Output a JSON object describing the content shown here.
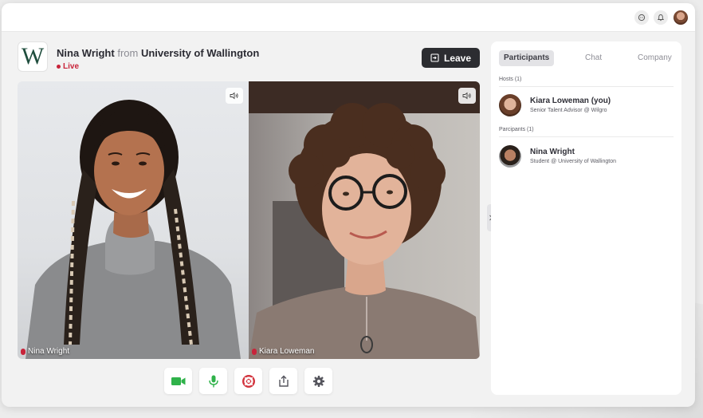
{
  "header": {
    "message_icon": "chat-bubble-icon",
    "notification_icon": "bell-icon",
    "user_avatar": "avatar"
  },
  "session": {
    "logo_letter": "W",
    "student_name": "Nina Wright",
    "from_text": "from",
    "university": "University of Wallington",
    "live_label": "Live",
    "leave_label": "Leave"
  },
  "videos": [
    {
      "name": "Nina Wright"
    },
    {
      "name": "Kiara Loweman"
    }
  ],
  "controls": [
    {
      "icon": "camera-icon",
      "color": "#2fb24a"
    },
    {
      "icon": "microphone-icon",
      "color": "#2fb24a"
    },
    {
      "icon": "lifebuoy-icon",
      "color": "#d2323c"
    },
    {
      "icon": "share-icon",
      "color": "#55555d"
    },
    {
      "icon": "gear-icon",
      "color": "#55555d"
    }
  ],
  "sidebar": {
    "tabs": [
      "Participants",
      "Chat",
      "Company"
    ],
    "hosts_label": "Hosts (1)",
    "participants_label": "Parcipants (1)",
    "host": {
      "name": "Kiara Loweman (you)",
      "subtitle": "Senior Talent Advisor @ Wilgro"
    },
    "participant": {
      "name": "Nina Wright",
      "subtitle": "Student @ University of Wallington"
    }
  },
  "colors": {
    "live": "#c8243a",
    "leave_bg": "#2c2d31",
    "logo": "#1f4d3d"
  }
}
